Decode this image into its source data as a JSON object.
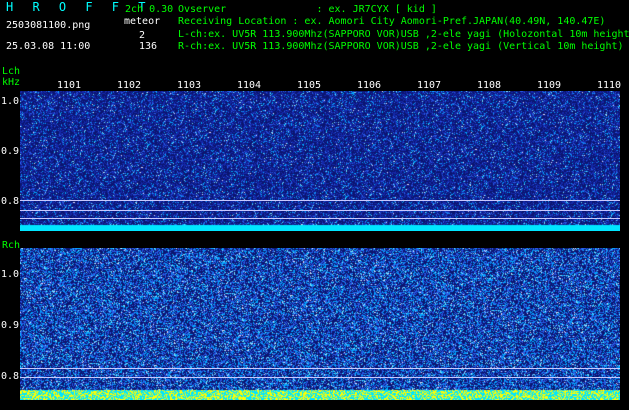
{
  "header": {
    "title": "H R O F F T",
    "filename": "2503081100.png",
    "timestamp": "25.03.08 11:00",
    "mode": "2ch 0.30",
    "meteor_label": "meteor",
    "count_l": "2",
    "count_r": "136"
  },
  "info": {
    "observer": "Ovserver               : ex. JR7CYX [ kid ]",
    "location": "Receiving Location : ex. Aomori City Aomori-Pref.JAPAN(40.49N, 140.47E)",
    "lch": "L-ch:ex. UV5R 113.900Mhz(SAPPORO VOR)USB ,2-ele yagi (Holozontal 10m height)",
    "rch": "R-ch:ex. UV5R 113.900Mhz(SAPPORO VOR)USB ,2-ele yagi (Vertical 10m height)"
  },
  "axes": {
    "lch_label": "Lch",
    "unit": "kHz",
    "rch_label": "Rch",
    "time_ticks": [
      "1101",
      "1102",
      "1103",
      "1104",
      "1105",
      "1106",
      "1107",
      "1108",
      "1109",
      "1110"
    ],
    "lch_freq_ticks": [
      "1.0",
      "0.9",
      "0.8"
    ],
    "rch_freq_ticks": [
      "1.0",
      "0.9",
      "0.8"
    ]
  },
  "colors": {
    "background": "#000000",
    "text_cyan": "#00ffff",
    "text_green": "#00ff00",
    "noise_base": "#0a1a8a",
    "band_cyan": "#00e6ff",
    "band_yellow": "#ffff00"
  }
}
